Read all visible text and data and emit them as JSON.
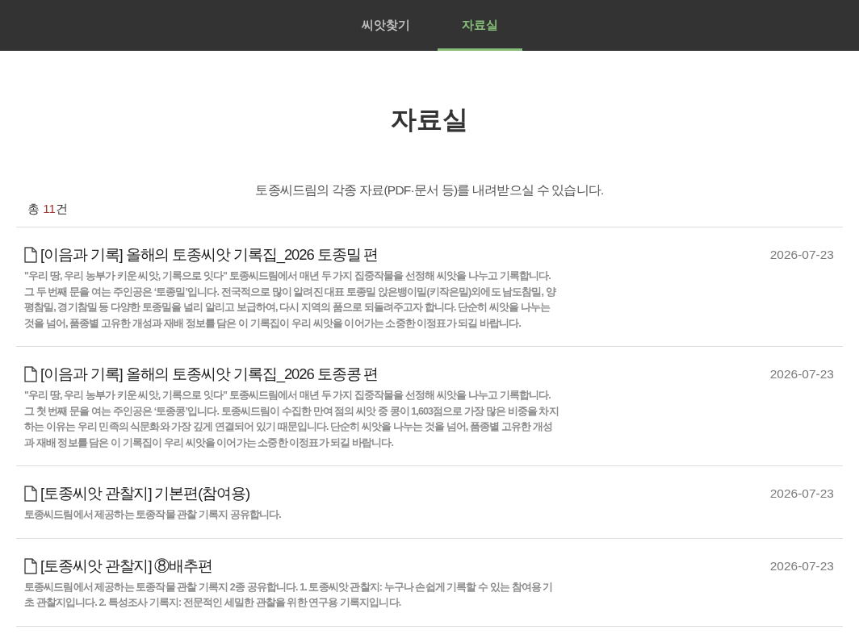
{
  "nav": {
    "tabs": [
      {
        "label": "씨앗찾기",
        "selected": false
      },
      {
        "label": "자료실",
        "selected": true
      }
    ]
  },
  "page": {
    "title": "자료실",
    "subtitle": "토종씨드림의 각종 자료(PDF·문서 등)를 내려받으실 수 있습니다.",
    "total": {
      "prefix": "총",
      "count": "11",
      "suffix": "건"
    }
  },
  "items": [
    {
      "title": "[이음과 기록] 올해의 토종씨앗 기록집_2026 토종밀 편",
      "description": "\"우리 땅, 우리 농부가 키운 씨앗, 기록으로 잇다\" 토종씨드림에서 매년 두 가지 집중작물을 선정해 씨앗을 나누고 기록합니다. 그 두 번째 문을 여는 주인공은 ‘토종밀’입니다. 전국적으로 많이 알려진 대표 토종밀 앉은뱅이밀(키작은밀)외에도 남도참밀, 양평참밀, 경기참밀 등 다양한 토종밀을 널리 알리고 보급하여, 다시 지역의 품으로 되돌려주고자 합니다. 단순히 씨앗을 나누는 것을 넘어, 품종별 고유한 개성과 재배 정보를 담은 이 기록집이 우리 씨앗을 이어가는 소중한 이정표가 되길 바랍니다.",
      "date": "2026-07-23"
    },
    {
      "title": "[이음과 기록] 올해의 토종씨앗 기록집_2026 토종콩 편",
      "description": "\"우리 땅, 우리 농부가 키운 씨앗, 기록으로 잇다\" 토종씨드림에서 매년 두 가지 집중작물을 선정해 씨앗을 나누고 기록합니다. 그 첫 번째 문을 여는 주인공은 ‘토종콩’입니다. 토종씨드림이 수집한 만여 점의 씨앗 중 콩이 1,603점으로 가장 많은 비중을 차지하는 이유는 우리 민족의 식문화와 가장 깊게 연결되어 있기 때문입니다. 단순히 씨앗을 나누는 것을 넘어, 품종별 고유한 개성과 재배 정보를 담은 이 기록집이 우리 씨앗을 이어가는 소중한 이정표가 되길 바랍니다.",
      "date": "2026-07-23"
    },
    {
      "title": "[토종씨앗 관찰지] 기본편(참여용)",
      "description": "토종씨드림에서 제공하는 토종작물 관찰 기록지 공유합니다.",
      "date": "2026-07-23"
    },
    {
      "title": "[토종씨앗 관찰지] ⑧배추편",
      "description": "토종씨드림에서 제공하는 토종작물 관찰 기록지 2종 공유합니다. 1. 토종씨앗 관찰지: 누구나 손쉽게 기록할 수 있는 참여용 기초 관찰지입니다. 2. 특성조사 기록지: 전문적인 세밀한 관찰을 위한 연구용 기록지입니다.",
      "date": "2026-07-23"
    }
  ]
}
